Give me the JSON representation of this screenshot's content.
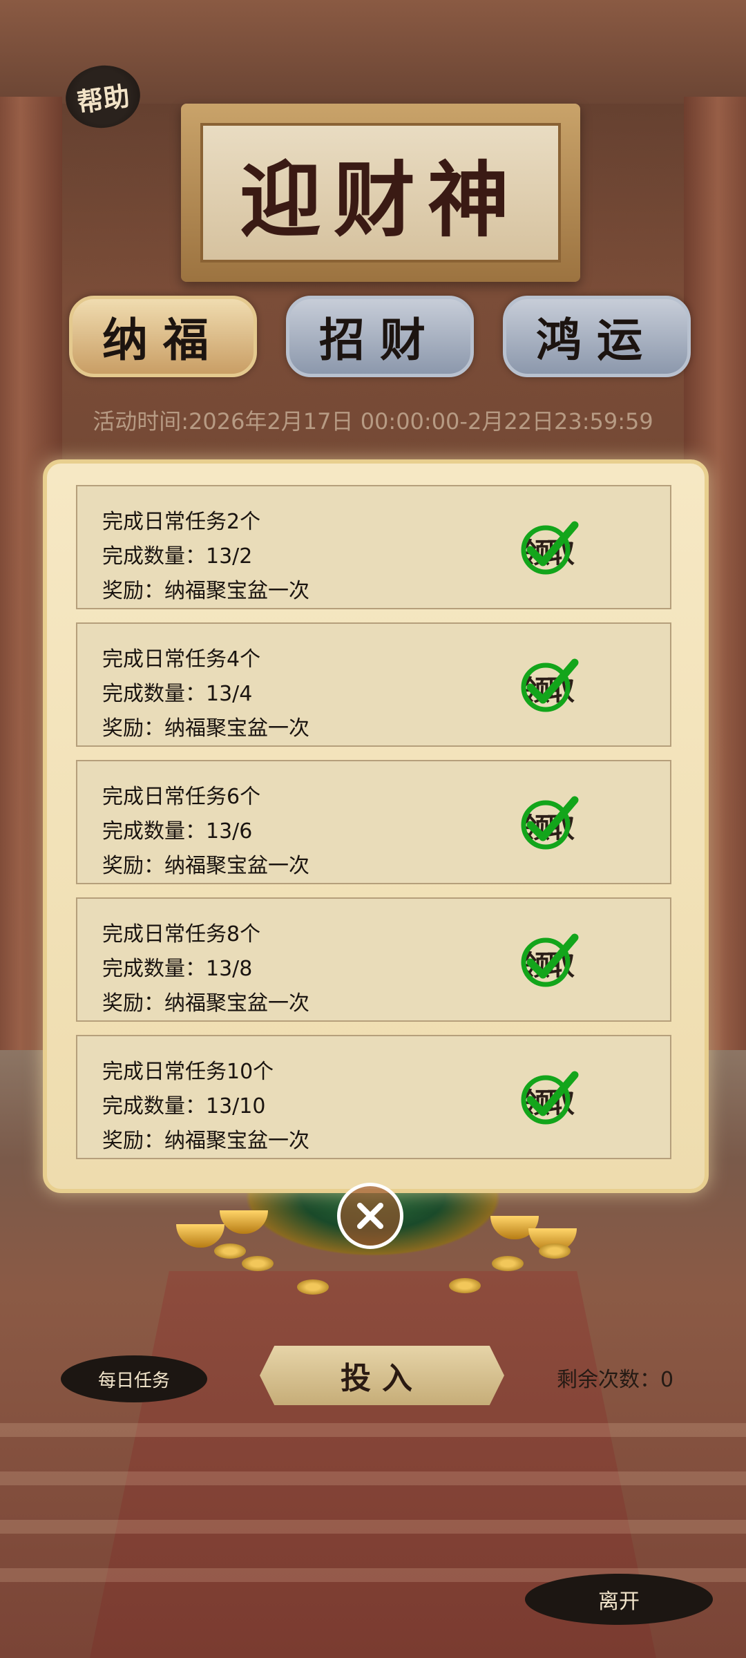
{
  "header": {
    "help_label": "帮助",
    "title": "迎财神"
  },
  "tabs": [
    {
      "label": "纳福",
      "active": true
    },
    {
      "label": "招财",
      "active": false
    },
    {
      "label": "鸿运",
      "active": false
    }
  ],
  "activity_time": "活动时间:2026年2月17日 00:00:00-2月22日23:59:59",
  "tasks": [
    {
      "title": "完成日常任务2个",
      "progress": "完成数量：13/2",
      "reward": "奖励：纳福聚宝盆一次",
      "claim_label": "领取",
      "status_icon": "checkmark-icon"
    },
    {
      "title": "完成日常任务4个",
      "progress": "完成数量：13/4",
      "reward": "奖励：纳福聚宝盆一次",
      "claim_label": "领取",
      "status_icon": "checkmark-icon"
    },
    {
      "title": "完成日常任务6个",
      "progress": "完成数量：13/6",
      "reward": "奖励：纳福聚宝盆一次",
      "claim_label": "领取",
      "status_icon": "checkmark-icon"
    },
    {
      "title": "完成日常任务8个",
      "progress": "完成数量：13/8",
      "reward": "奖励：纳福聚宝盆一次",
      "claim_label": "领取",
      "status_icon": "checkmark-icon"
    },
    {
      "title": "完成日常任务10个",
      "progress": "完成数量：13/10",
      "reward": "奖励：纳福聚宝盆一次",
      "claim_label": "领取",
      "status_icon": "checkmark-icon"
    }
  ],
  "footer": {
    "daily_task_label": "每日任务",
    "invest_label": "投入",
    "remaining_label": "剩余次数：0",
    "leave_label": "离开"
  },
  "colors": {
    "check_green": "#13a51b",
    "panel_bg": "#f6e8c4",
    "task_bg": "#e9dcb9"
  }
}
